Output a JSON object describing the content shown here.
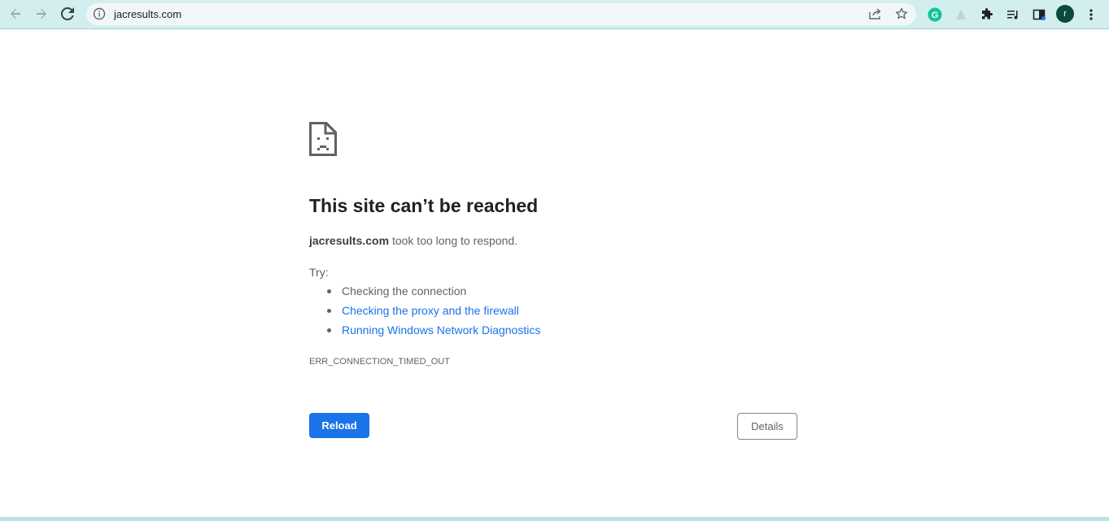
{
  "browser": {
    "url": "jacresults.com",
    "profile_initial": "r",
    "icons": {
      "back": "arrow-left-icon",
      "forward": "arrow-right-icon",
      "reload": "reload-icon",
      "info": "info-icon",
      "share": "share-icon",
      "bookmark": "star-icon",
      "grammarly": "grammarly-icon",
      "extension2": "triangle-extension-icon",
      "extensions": "puzzle-icon",
      "media": "media-queue-icon",
      "sidepanel": "side-panel-icon",
      "menu": "kebab-menu-icon"
    },
    "colors": {
      "toolbar": "#d3eeee",
      "omnibox": "#f1f7f7",
      "accent": "#1a73e8"
    }
  },
  "error": {
    "title": "This site can’t be reached",
    "host": "jacresults.com",
    "message": "took too long to respond.",
    "try_label": "Try:",
    "suggestions": [
      {
        "text": "Checking the connection",
        "is_link": false
      },
      {
        "text": "Checking the proxy and the firewall",
        "is_link": true
      },
      {
        "text": "Running Windows Network Diagnostics",
        "is_link": true
      }
    ],
    "code": "ERR_CONNECTION_TIMED_OUT",
    "reload_label": "Reload",
    "details_label": "Details",
    "icon": "sad-document-icon"
  }
}
